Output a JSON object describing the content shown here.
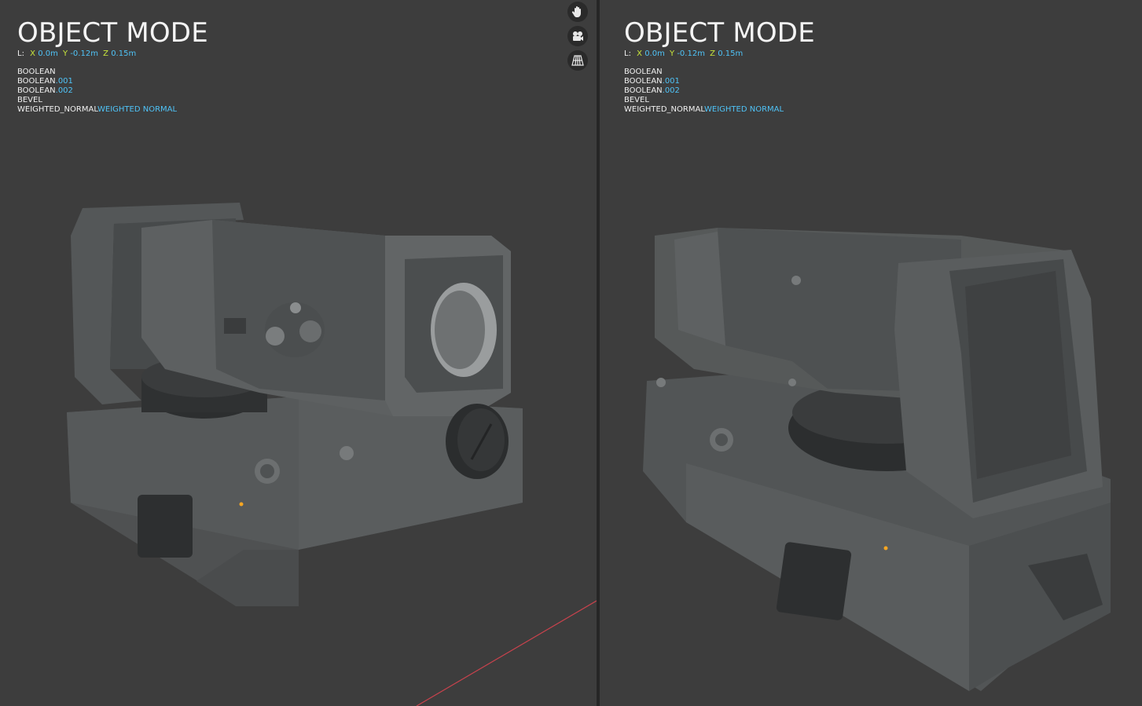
{
  "viewports": [
    {
      "mode_title": "OBJECT MODE",
      "location": {
        "label": "L:",
        "x_axis": "X",
        "x": "0.0m",
        "y_axis": "Y",
        "y": "-0.12m",
        "z_axis": "Z",
        "z": "0.15m"
      },
      "modifiers": [
        {
          "name": "BOOLEAN",
          "suffix": ""
        },
        {
          "name": "BOOLEAN",
          "suffix": ".001"
        },
        {
          "name": "BOOLEAN",
          "suffix": ".002"
        },
        {
          "name": "BEVEL",
          "suffix": ""
        },
        {
          "name": "WEIGHTED_NORMAL",
          "suffix": "WEIGHTED NORMAL"
        }
      ],
      "gizmos": [
        "hand-pan-icon",
        "camera-icon",
        "perspective-grid-icon"
      ]
    },
    {
      "mode_title": "OBJECT MODE",
      "location": {
        "label": "L:",
        "x_axis": "X",
        "x": "0.0m",
        "y_axis": "Y",
        "y": "-0.12m",
        "z_axis": "Z",
        "z": "0.15m"
      },
      "modifiers": [
        {
          "name": "BOOLEAN",
          "suffix": ""
        },
        {
          "name": "BOOLEAN",
          "suffix": ".001"
        },
        {
          "name": "BOOLEAN",
          "suffix": ".002"
        },
        {
          "name": "BEVEL",
          "suffix": ""
        },
        {
          "name": "WEIGHTED_NORMAL",
          "suffix": "WEIGHTED NORMAL"
        }
      ]
    }
  ],
  "colors": {
    "background": "#3d3d3d",
    "text": "#f0f0f0",
    "axis_label": "#c8e63c",
    "value_highlight": "#4fc3f7",
    "x_axis_line": "#c9424d",
    "origin_dot": "#f5a623"
  }
}
